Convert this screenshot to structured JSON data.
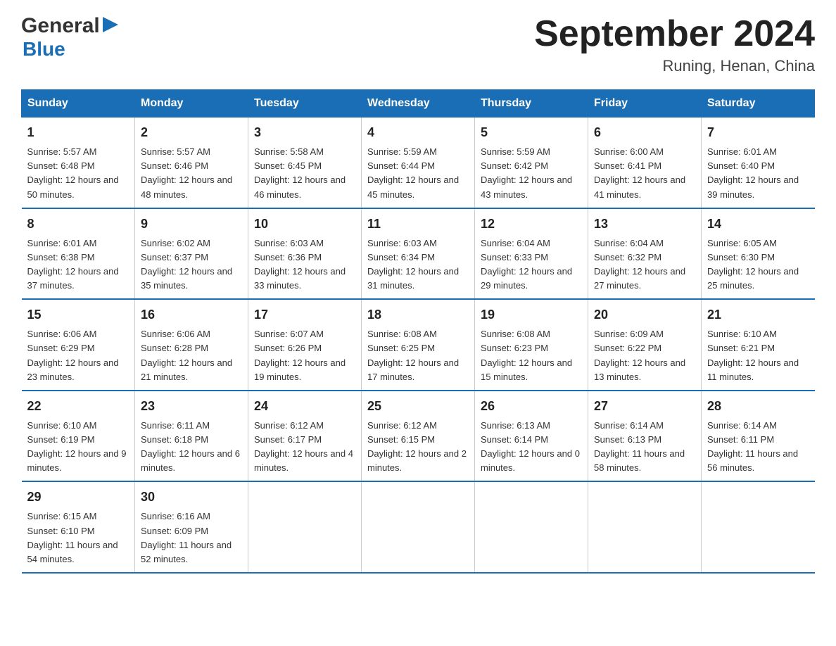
{
  "logo": {
    "general": "General",
    "blue": "Blue"
  },
  "title": "September 2024",
  "subtitle": "Runing, Henan, China",
  "days_header": [
    "Sunday",
    "Monday",
    "Tuesday",
    "Wednesday",
    "Thursday",
    "Friday",
    "Saturday"
  ],
  "weeks": [
    [
      {
        "day": "1",
        "sunrise": "5:57 AM",
        "sunset": "6:48 PM",
        "daylight": "12 hours and 50 minutes."
      },
      {
        "day": "2",
        "sunrise": "5:57 AM",
        "sunset": "6:46 PM",
        "daylight": "12 hours and 48 minutes."
      },
      {
        "day": "3",
        "sunrise": "5:58 AM",
        "sunset": "6:45 PM",
        "daylight": "12 hours and 46 minutes."
      },
      {
        "day": "4",
        "sunrise": "5:59 AM",
        "sunset": "6:44 PM",
        "daylight": "12 hours and 45 minutes."
      },
      {
        "day": "5",
        "sunrise": "5:59 AM",
        "sunset": "6:42 PM",
        "daylight": "12 hours and 43 minutes."
      },
      {
        "day": "6",
        "sunrise": "6:00 AM",
        "sunset": "6:41 PM",
        "daylight": "12 hours and 41 minutes."
      },
      {
        "day": "7",
        "sunrise": "6:01 AM",
        "sunset": "6:40 PM",
        "daylight": "12 hours and 39 minutes."
      }
    ],
    [
      {
        "day": "8",
        "sunrise": "6:01 AM",
        "sunset": "6:38 PM",
        "daylight": "12 hours and 37 minutes."
      },
      {
        "day": "9",
        "sunrise": "6:02 AM",
        "sunset": "6:37 PM",
        "daylight": "12 hours and 35 minutes."
      },
      {
        "day": "10",
        "sunrise": "6:03 AM",
        "sunset": "6:36 PM",
        "daylight": "12 hours and 33 minutes."
      },
      {
        "day": "11",
        "sunrise": "6:03 AM",
        "sunset": "6:34 PM",
        "daylight": "12 hours and 31 minutes."
      },
      {
        "day": "12",
        "sunrise": "6:04 AM",
        "sunset": "6:33 PM",
        "daylight": "12 hours and 29 minutes."
      },
      {
        "day": "13",
        "sunrise": "6:04 AM",
        "sunset": "6:32 PM",
        "daylight": "12 hours and 27 minutes."
      },
      {
        "day": "14",
        "sunrise": "6:05 AM",
        "sunset": "6:30 PM",
        "daylight": "12 hours and 25 minutes."
      }
    ],
    [
      {
        "day": "15",
        "sunrise": "6:06 AM",
        "sunset": "6:29 PM",
        "daylight": "12 hours and 23 minutes."
      },
      {
        "day": "16",
        "sunrise": "6:06 AM",
        "sunset": "6:28 PM",
        "daylight": "12 hours and 21 minutes."
      },
      {
        "day": "17",
        "sunrise": "6:07 AM",
        "sunset": "6:26 PM",
        "daylight": "12 hours and 19 minutes."
      },
      {
        "day": "18",
        "sunrise": "6:08 AM",
        "sunset": "6:25 PM",
        "daylight": "12 hours and 17 minutes."
      },
      {
        "day": "19",
        "sunrise": "6:08 AM",
        "sunset": "6:23 PM",
        "daylight": "12 hours and 15 minutes."
      },
      {
        "day": "20",
        "sunrise": "6:09 AM",
        "sunset": "6:22 PM",
        "daylight": "12 hours and 13 minutes."
      },
      {
        "day": "21",
        "sunrise": "6:10 AM",
        "sunset": "6:21 PM",
        "daylight": "12 hours and 11 minutes."
      }
    ],
    [
      {
        "day": "22",
        "sunrise": "6:10 AM",
        "sunset": "6:19 PM",
        "daylight": "12 hours and 9 minutes."
      },
      {
        "day": "23",
        "sunrise": "6:11 AM",
        "sunset": "6:18 PM",
        "daylight": "12 hours and 6 minutes."
      },
      {
        "day": "24",
        "sunrise": "6:12 AM",
        "sunset": "6:17 PM",
        "daylight": "12 hours and 4 minutes."
      },
      {
        "day": "25",
        "sunrise": "6:12 AM",
        "sunset": "6:15 PM",
        "daylight": "12 hours and 2 minutes."
      },
      {
        "day": "26",
        "sunrise": "6:13 AM",
        "sunset": "6:14 PM",
        "daylight": "12 hours and 0 minutes."
      },
      {
        "day": "27",
        "sunrise": "6:14 AM",
        "sunset": "6:13 PM",
        "daylight": "11 hours and 58 minutes."
      },
      {
        "day": "28",
        "sunrise": "6:14 AM",
        "sunset": "6:11 PM",
        "daylight": "11 hours and 56 minutes."
      }
    ],
    [
      {
        "day": "29",
        "sunrise": "6:15 AM",
        "sunset": "6:10 PM",
        "daylight": "11 hours and 54 minutes."
      },
      {
        "day": "30",
        "sunrise": "6:16 AM",
        "sunset": "6:09 PM",
        "daylight": "11 hours and 52 minutes."
      },
      null,
      null,
      null,
      null,
      null
    ]
  ]
}
